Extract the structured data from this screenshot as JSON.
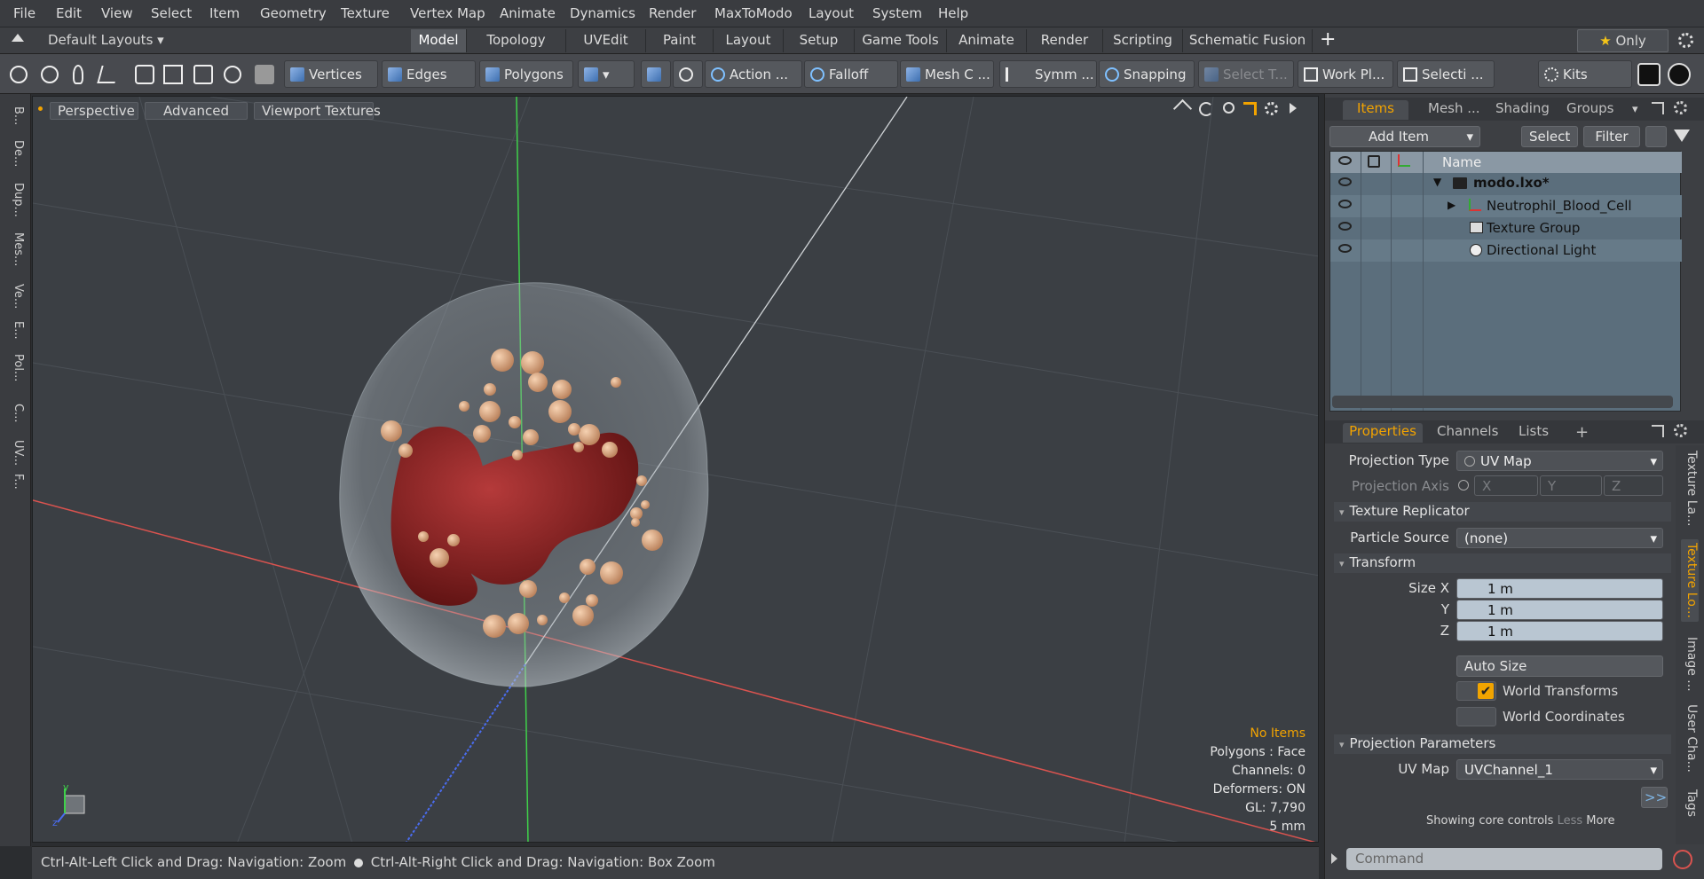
{
  "menubar": {
    "items": [
      "File",
      "Edit",
      "View",
      "Select",
      "Item",
      "Geometry",
      "Texture",
      "Vertex Map",
      "Animate",
      "Dynamics",
      "Render",
      "MaxToModo",
      "Layout",
      "System",
      "Help"
    ]
  },
  "layoutbar": {
    "layout_name": "Default Layouts",
    "tabs": [
      "Model",
      "Topology",
      "UVEdit",
      "Paint",
      "Layout",
      "Setup",
      "Game Tools",
      "Animate",
      "Render",
      "Scripting",
      "Schematic Fusion"
    ],
    "active_tab": "Model",
    "add": "+",
    "only": "Only",
    "star": "★"
  },
  "toolbar": {
    "vertices": "Vertices",
    "edges": "Edges",
    "polygons": "Polygons",
    "action": "Action",
    "falloff": "Falloff",
    "mesh": "Mesh C ...",
    "symm": "Symm ...",
    "snapping": "Snapping",
    "select_t": "Select T...",
    "work_plane": "Work Pl...",
    "selecti": "Selecti ...",
    "kits": "Kits",
    "dots": "...",
    "caret": "▾"
  },
  "leftstrip": {
    "tabs": [
      "B...",
      "De...",
      "Dup...",
      "Mes...",
      "Ve...",
      "E...",
      "Pol...",
      "C...",
      "UV...",
      "F..."
    ]
  },
  "viewport": {
    "perspective": "Perspective",
    "advanced": "Advanced",
    "viewport_textures": "Viewport Textures",
    "info": {
      "no_items": "No Items",
      "polygons": "Polygons : Face",
      "channels": "Channels: 0",
      "deformers": "Deformers: ON",
      "gl": "GL: 7,790",
      "scale": "5 mm"
    },
    "axis_x": "x",
    "axis_y": "y",
    "axis_z": "z"
  },
  "statusbar": {
    "hint1": "Ctrl-Alt-Left Click and Drag: Navigation: Zoom",
    "hint2": "Ctrl-Alt-Right Click and Drag: Navigation: Box Zoom"
  },
  "items_panel": {
    "tabs": [
      "Items",
      "Mesh ...",
      "Shading",
      "Groups"
    ],
    "active_tab": "Items",
    "add_item": "Add Item",
    "select": "Select",
    "filter": "Filter",
    "column_name": "Name",
    "rows": [
      {
        "name": "modo.lxo*",
        "indent": 0,
        "expanded": "▼"
      },
      {
        "name": "Neutrophil_Blood_Cell",
        "indent": 1,
        "expanded": "▶"
      },
      {
        "name": "Texture Group",
        "indent": 1,
        "expanded": ""
      },
      {
        "name": "Directional Light",
        "indent": 1,
        "expanded": ""
      }
    ]
  },
  "properties_panel": {
    "tabs": [
      "Properties",
      "Channels",
      "Lists"
    ],
    "active_tab": "Properties",
    "add": "+",
    "projection_type_label": "Projection Type",
    "projection_type_value": "UV Map",
    "projection_axis_label": "Projection Axis",
    "axis_x": "X",
    "axis_y": "Y",
    "axis_z": "Z",
    "section_texture_replicator": "Texture Replicator",
    "particle_source_label": "Particle Source",
    "particle_source_value": "(none)",
    "section_transform": "Transform",
    "size_x_label": "Size X",
    "size_y_label": "Y",
    "size_z_label": "Z",
    "size_x": "1 m",
    "size_y": "1 m",
    "size_z": "1 m",
    "auto_size": "Auto Size",
    "world_transforms": "World Transforms",
    "world_coordinates": "World Coordinates",
    "world_transforms_checked": "✔",
    "section_projection_params": "Projection Parameters",
    "uv_map_label": "UV Map",
    "uv_map_value": "UVChannel_1",
    "more_btn": ">>",
    "showing": "Showing core controls",
    "less": "Less",
    "more": "More",
    "command_placeholder": "Command",
    "side_tabs": [
      "Texture La...",
      "Texture Lo...",
      "Image ...",
      "User Cha...",
      "Tags"
    ],
    "active_side_tab": "Texture Lo..."
  },
  "colors": {
    "accent": "#f2a300",
    "nucleus": "#8a1f1f",
    "granule": "#e3b088",
    "x_axis": "#d9534f",
    "y_axis": "#3fd14a",
    "z_axis": "#4a6cf0"
  }
}
